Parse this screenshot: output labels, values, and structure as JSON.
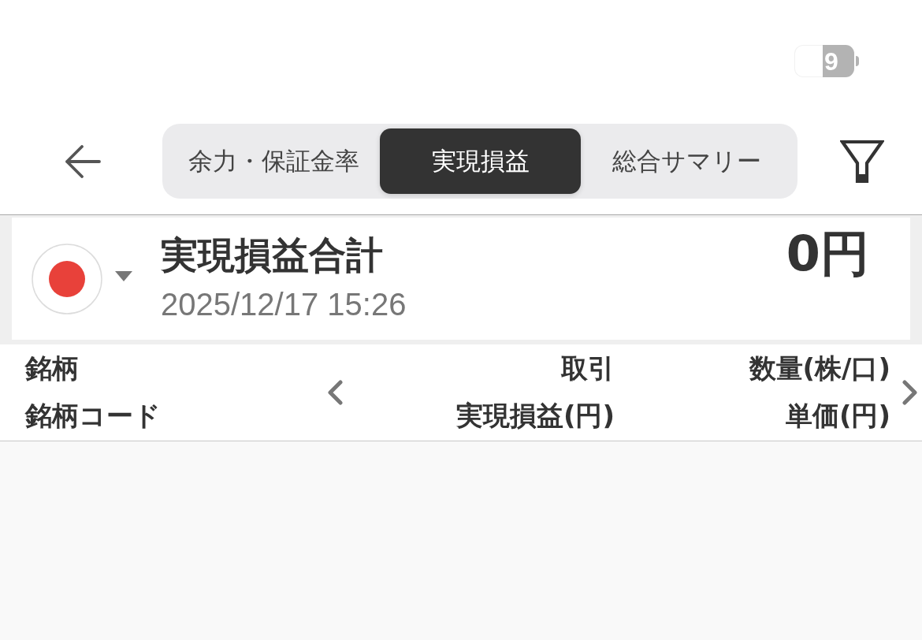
{
  "status_bar": {
    "battery": "9"
  },
  "header": {
    "tabs": [
      {
        "label": "余力・保証金率",
        "selected": false
      },
      {
        "label": "実現損益",
        "selected": true
      },
      {
        "label": "総合サマリー",
        "selected": false
      }
    ]
  },
  "summary": {
    "title": "実現損益合計",
    "timestamp": "2025/12/17 15:26",
    "total": "0円"
  },
  "table": {
    "columns": [
      {
        "label": "銘柄",
        "sublabel": "銘柄コード"
      },
      {
        "label": "取引",
        "sublabel": "実現損益(円)"
      },
      {
        "label": "数量(株/口)",
        "sublabel": "単価(円)"
      }
    ]
  }
}
